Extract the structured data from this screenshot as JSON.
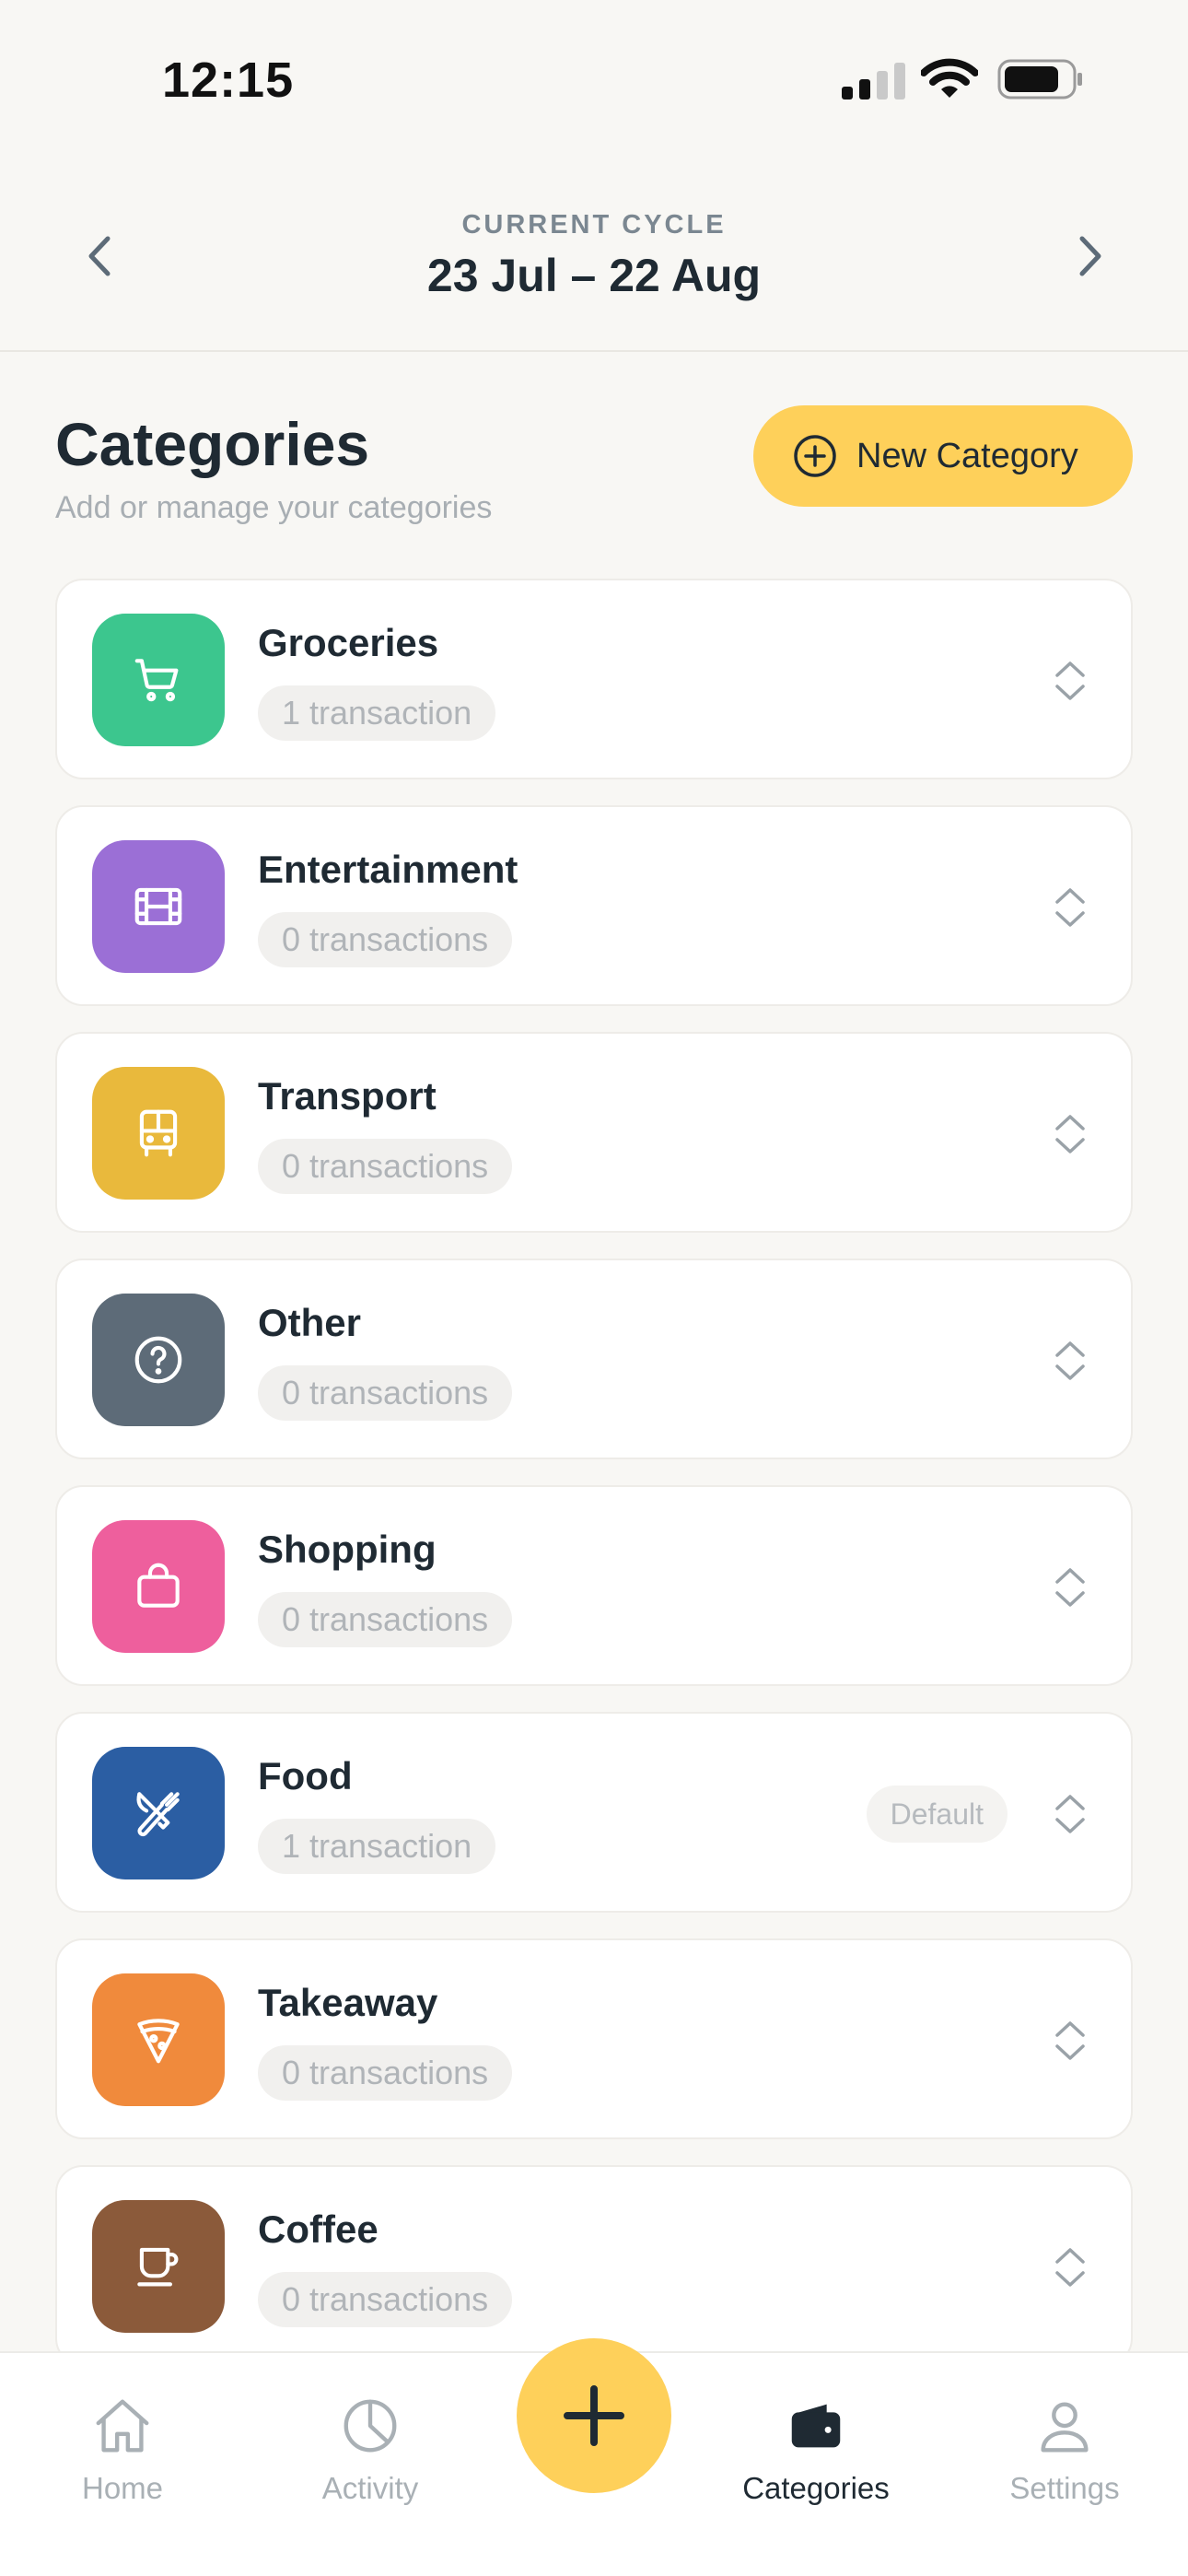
{
  "status_bar": {
    "time": "12:15"
  },
  "cycle": {
    "label": "CURRENT CYCLE",
    "range": "23 Jul – 22 Aug"
  },
  "header": {
    "title": "Categories",
    "subtitle": "Add or manage your categories",
    "new_button_label": "New Category"
  },
  "categories": [
    {
      "name": "Groceries",
      "count": "1 transaction",
      "color": "#3cc68e",
      "icon": "cart-icon"
    },
    {
      "name": "Entertainment",
      "count": "0 transactions",
      "color": "#9b6fd6",
      "icon": "film-icon"
    },
    {
      "name": "Transport",
      "count": "0 transactions",
      "color": "#e9b93c",
      "icon": "bus-icon"
    },
    {
      "name": "Other",
      "count": "0 transactions",
      "color": "#5d6b78",
      "icon": "question-icon"
    },
    {
      "name": "Shopping",
      "count": "0 transactions",
      "color": "#ee5f9d",
      "icon": "bag-icon"
    },
    {
      "name": "Food",
      "count": "1 transaction",
      "color": "#2b5ea3",
      "icon": "utensils-icon",
      "badge": "Default"
    },
    {
      "name": "Takeaway",
      "count": "0 transactions",
      "color": "#f08a3c",
      "icon": "pizza-icon"
    },
    {
      "name": "Coffee",
      "count": "0 transactions",
      "color": "#8b5a3a",
      "icon": "coffee-icon"
    }
  ],
  "tabs": {
    "home": "Home",
    "activity": "Activity",
    "categories": "Categories",
    "settings": "Settings"
  }
}
